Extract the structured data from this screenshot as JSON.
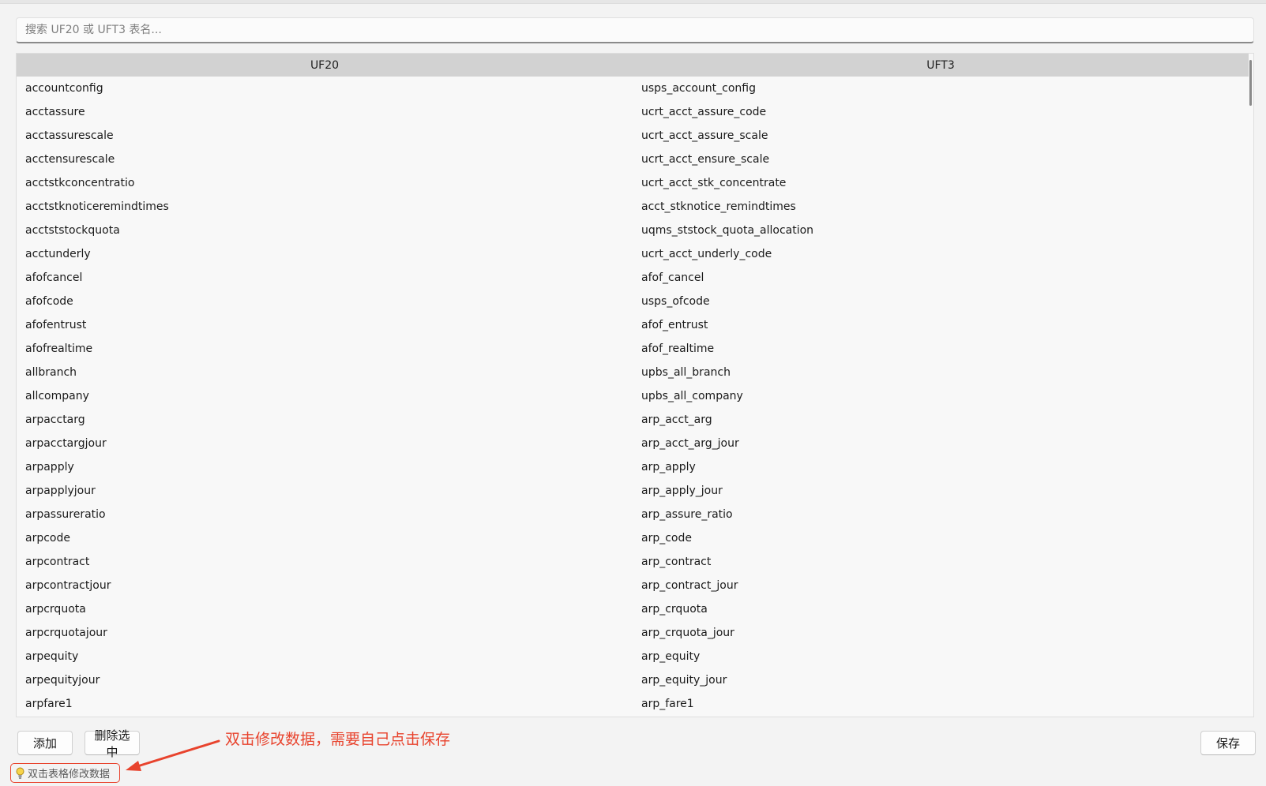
{
  "search": {
    "placeholder": "搜索 UF20 或 UFT3 表名..."
  },
  "table": {
    "columns": [
      "UF20",
      "UFT3"
    ],
    "rows": [
      [
        "accountconfig",
        "usps_account_config"
      ],
      [
        "acctassure",
        "ucrt_acct_assure_code"
      ],
      [
        "acctassurescale",
        "ucrt_acct_assure_scale"
      ],
      [
        "acctensurescale",
        "ucrt_acct_ensure_scale"
      ],
      [
        "acctstkconcentratio",
        "ucrt_acct_stk_concentrate"
      ],
      [
        "acctstknoticeremindtimes",
        "acct_stknotice_remindtimes"
      ],
      [
        "acctststockquota",
        "uqms_ststock_quota_allocation"
      ],
      [
        "acctunderly",
        "ucrt_acct_underly_code"
      ],
      [
        "afofcancel",
        "afof_cancel"
      ],
      [
        "afofcode",
        "usps_ofcode"
      ],
      [
        "afofentrust",
        "afof_entrust"
      ],
      [
        "afofrealtime",
        "afof_realtime"
      ],
      [
        "allbranch",
        "upbs_all_branch"
      ],
      [
        "allcompany",
        "upbs_all_company"
      ],
      [
        "arpacctarg",
        "arp_acct_arg"
      ],
      [
        "arpacctargjour",
        "arp_acct_arg_jour"
      ],
      [
        "arpapply",
        "arp_apply"
      ],
      [
        "arpapplyjour",
        "arp_apply_jour"
      ],
      [
        "arpassureratio",
        "arp_assure_ratio"
      ],
      [
        "arpcode",
        "arp_code"
      ],
      [
        "arpcontract",
        "arp_contract"
      ],
      [
        "arpcontractjour",
        "arp_contract_jour"
      ],
      [
        "arpcrquota",
        "arp_crquota"
      ],
      [
        "arpcrquotajour",
        "arp_crquota_jour"
      ],
      [
        "arpequity",
        "arp_equity"
      ],
      [
        "arpequityjour",
        "arp_equity_jour"
      ],
      [
        "arpfare1",
        "arp_fare1"
      ]
    ]
  },
  "toolbar": {
    "add_label": "添加",
    "delete_label": "删除选中",
    "save_label": "保存"
  },
  "annotation": {
    "text": "双击修改数据，需要自己点击保存",
    "color": "#e8432d"
  },
  "hint": {
    "icon": "lightbulb-icon",
    "text": "双击表格修改数据"
  }
}
